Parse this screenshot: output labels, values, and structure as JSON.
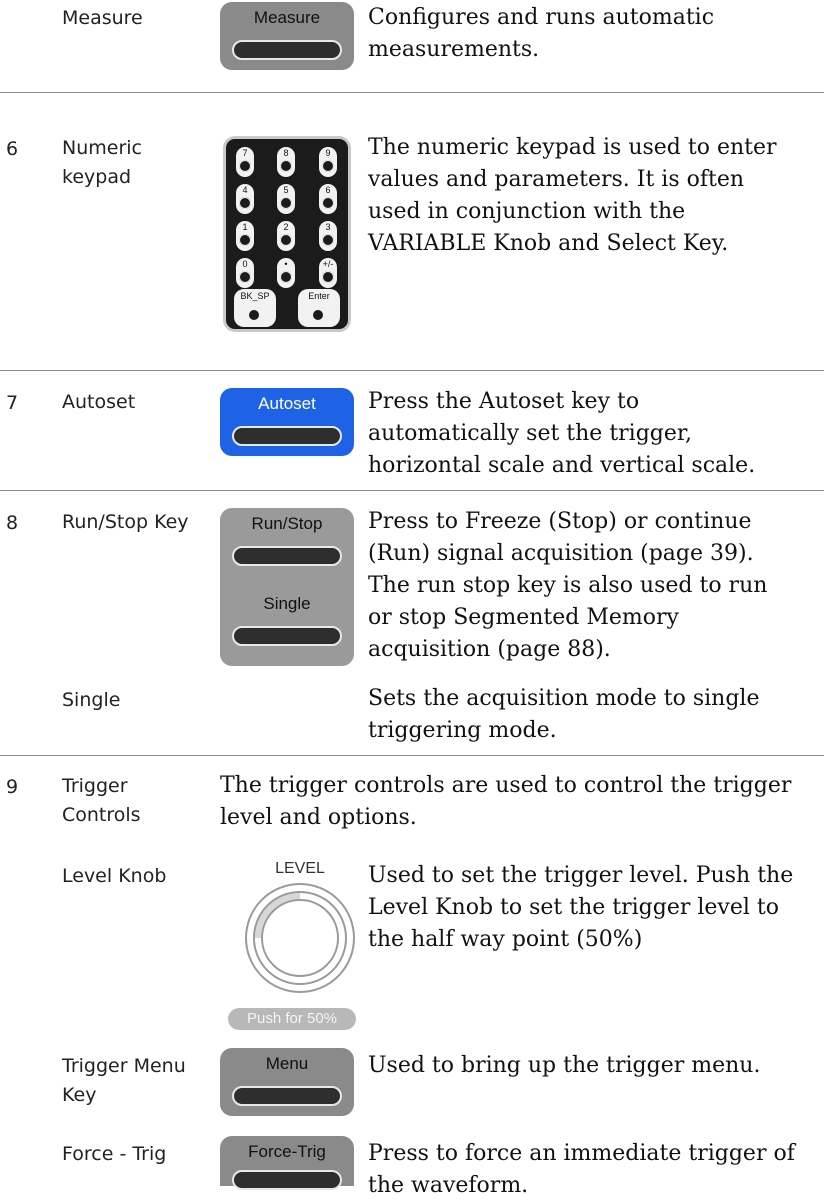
{
  "rows": {
    "measure": {
      "label": "Measure",
      "key_label": "Measure",
      "desc_line1": "Configures and runs automatic",
      "desc_line2": "measurements."
    },
    "numeric": {
      "num": "6",
      "label_line1": "Numeric",
      "label_line2": "keypad",
      "desc_line1": "The numeric keypad is used to enter",
      "desc_line2": "values and parameters. It is often",
      "desc_line3": "used in conjunction with the",
      "desc_line4": "VARIABLE Knob and Select Key.",
      "keys": [
        "7",
        "8",
        "9",
        "4",
        "5",
        "6",
        "1",
        "2",
        "3",
        "0",
        "•",
        "+/-"
      ],
      "bksp_label": "BK_SP",
      "enter_label": "Enter"
    },
    "autoset": {
      "num": "7",
      "label": "Autoset",
      "key_label": "Autoset",
      "desc_line1": "Press the Autoset key to",
      "desc_line2": "automatically set the trigger,",
      "desc_line3": "horizontal scale and vertical scale."
    },
    "runstop": {
      "num": "8",
      "label": "Run/Stop Key",
      "key_label": "Run/Stop",
      "single_key_label": "Single",
      "desc_line1": "Press to Freeze (Stop) or continue",
      "desc_line2": "(Run) signal acquisition (page 39).",
      "desc_line3": "The run stop key is also used to run",
      "desc_line4": "or stop Segmented Memory",
      "desc_line5": "acquisition (page 88)."
    },
    "single": {
      "label": "Single",
      "desc_line1": "Sets the acquisition mode to single",
      "desc_line2": "triggering mode."
    },
    "trigger": {
      "num": "9",
      "label_line1": "Trigger",
      "label_line2": "Controls",
      "desc_line1": "The trigger controls are used to control the trigger",
      "desc_line2": "level and options."
    },
    "level": {
      "label": "Level Knob",
      "knob_label": "LEVEL",
      "push_label": "Push for 50%",
      "desc_line1": "Used to set the trigger level. Push the",
      "desc_line2": "Level Knob to set the trigger level to",
      "desc_line3": "the half way point (50%)"
    },
    "trigmenu": {
      "label_line1": "Trigger Menu",
      "label_line2": "Key",
      "key_label": "Menu",
      "desc_line1": "Used to bring up the trigger menu."
    },
    "forcetrig": {
      "label": "Force - Trig",
      "key_label": "Force-Trig",
      "desc_line1": "Press to force an immediate trigger of",
      "desc_line2": "the waveform."
    }
  },
  "colors": {
    "key_gray": "#8a8a8a",
    "key_blue": "#1e63e6",
    "keypad_body": "#1b1b1b",
    "separator": "#8c8c8c"
  }
}
